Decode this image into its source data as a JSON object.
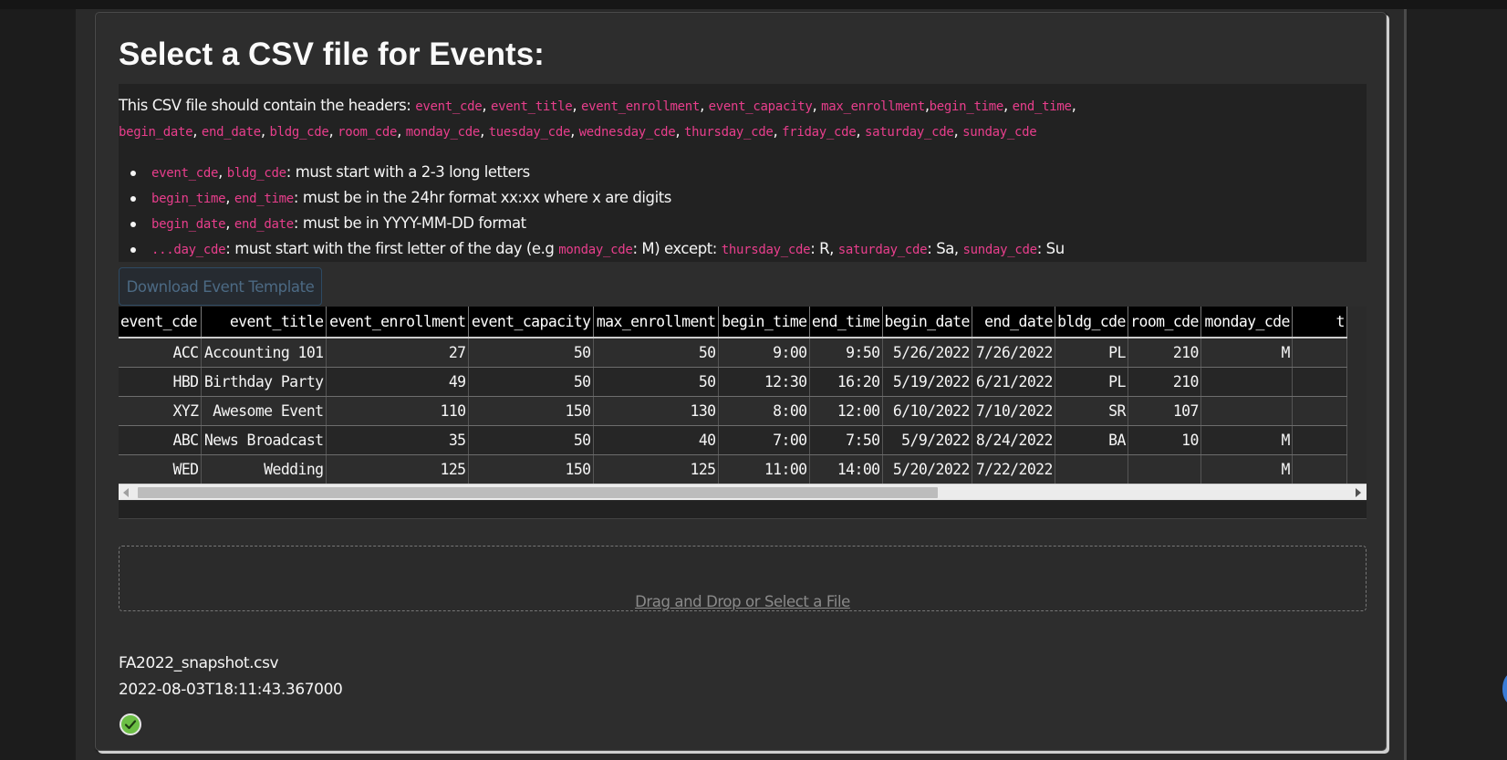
{
  "page": {
    "title": "Select a CSV file for Events:"
  },
  "description": {
    "intro": "This CSV file should contain the headers:",
    "headers": [
      "event_cde",
      "event_title",
      "event_enrollment",
      "event_capacity",
      "max_enrollment",
      "begin_time",
      "end_time",
      "begin_date",
      "end_date",
      "bldg_cde",
      "room_cde",
      "monday_cde",
      "tuesday_cde",
      "wednesday_cde",
      "thursday_cde",
      "friday_cde",
      "saturday_cde",
      "sunday_cde"
    ],
    "rules": [
      {
        "codes": [
          "event_cde",
          "bldg_cde"
        ],
        "text": ": must start with a 2-3 long letters"
      },
      {
        "codes": [
          "begin_time",
          "end_time"
        ],
        "text": ": must be in the 24hr format xx:xx where x are digits"
      },
      {
        "codes": [
          "begin_date",
          "end_date"
        ],
        "text": ": must be in YYYY-MM-DD format"
      }
    ],
    "day_rule": {
      "code": "...day_cde",
      "text1": ": must start with the first letter of the day (e.g ",
      "example_code": "monday_cde",
      "text2": ": M) except: ",
      "exceptions": [
        {
          "code": "thursday_cde",
          "value": ": R, "
        },
        {
          "code": "saturday_cde",
          "value": ": Sa, "
        },
        {
          "code": "sunday_cde",
          "value": ": Su"
        }
      ]
    }
  },
  "download_button": {
    "label": "Download Event Template"
  },
  "table": {
    "columns": [
      "event_cde",
      "event_title",
      "event_enrollment",
      "event_capacity",
      "max_enrollment",
      "begin_time",
      "end_time",
      "begin_date",
      "end_date",
      "bldg_cde",
      "room_cde",
      "monday_cde",
      "t"
    ],
    "rows": [
      [
        "ACC",
        "Accounting 101",
        "27",
        "50",
        "50",
        "9:00",
        "9:50",
        "5/26/2022",
        "7/26/2022",
        "PL",
        "210",
        "M",
        ""
      ],
      [
        "HBD",
        "Birthday Party",
        "49",
        "50",
        "50",
        "12:30",
        "16:20",
        "5/19/2022",
        "6/21/2022",
        "PL",
        "210",
        "",
        ""
      ],
      [
        "XYZ",
        "Awesome Event",
        "110",
        "150",
        "130",
        "8:00",
        "12:00",
        "6/10/2022",
        "7/10/2022",
        "SR",
        "107",
        "",
        ""
      ],
      [
        "ABC",
        "News Broadcast",
        "35",
        "50",
        "40",
        "7:00",
        "7:50",
        "5/9/2022",
        "8/24/2022",
        "BA",
        "10",
        "M",
        ""
      ],
      [
        "WED",
        "Wedding",
        "125",
        "150",
        "125",
        "11:00",
        "14:00",
        "5/20/2022",
        "7/22/2022",
        "",
        "",
        "M",
        ""
      ]
    ]
  },
  "upload": {
    "dropzone_label": "Drag and Drop or Select a File",
    "filename": "FA2022_snapshot.csv",
    "timestamp": "2022-08-03T18:11:43.367000",
    "status_icon": "check-circle-icon",
    "status_color": "#6cbf45"
  },
  "colors": {
    "code": "#e83e8c",
    "background": "#2d2d2d",
    "header_bg": "#000000"
  }
}
